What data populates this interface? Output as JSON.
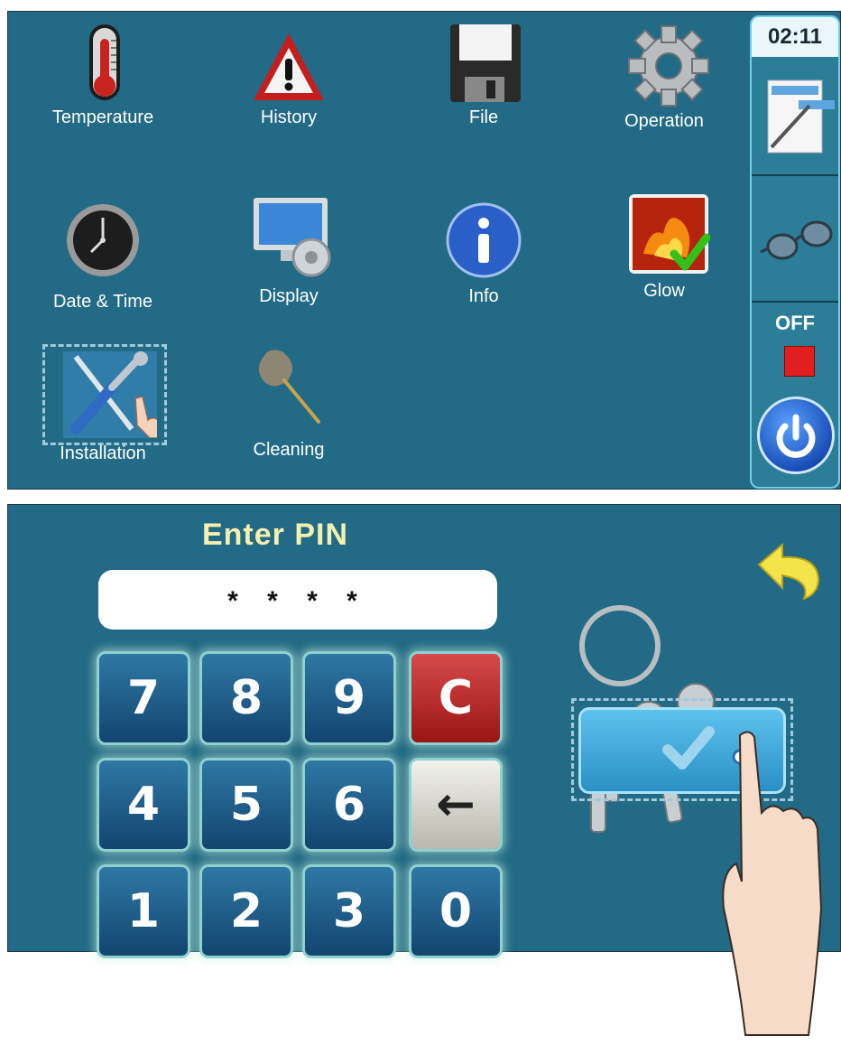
{
  "menu": {
    "tiles": [
      {
        "label": "Temperature",
        "icon": "thermometer-icon"
      },
      {
        "label": "History",
        "icon": "warning-icon"
      },
      {
        "label": "File",
        "icon": "floppy-disk-icon"
      },
      {
        "label": "Operation",
        "icon": "gear-icon"
      },
      {
        "label": "Date & Time",
        "icon": "clock-icon"
      },
      {
        "label": "Display",
        "icon": "monitor-settings-icon"
      },
      {
        "label": "Info",
        "icon": "info-icon"
      },
      {
        "label": "Glow",
        "icon": "flame-check-icon"
      },
      {
        "label": "Installation",
        "icon": "tools-icon"
      },
      {
        "label": "Cleaning",
        "icon": "feather-duster-icon"
      }
    ]
  },
  "sidebar": {
    "clock": "02:11",
    "status": "OFF",
    "status_color": "#e02020"
  },
  "pin": {
    "title": "Enter PIN",
    "masked_value": "* * * *",
    "keys": [
      "7",
      "8",
      "9",
      "C",
      "4",
      "5",
      "6",
      "←",
      "1",
      "2",
      "3",
      "0"
    ]
  },
  "colors": {
    "panel": "#226a85",
    "title_text": "#f5f0b0",
    "accent_cyan": "#6fd0e6"
  }
}
